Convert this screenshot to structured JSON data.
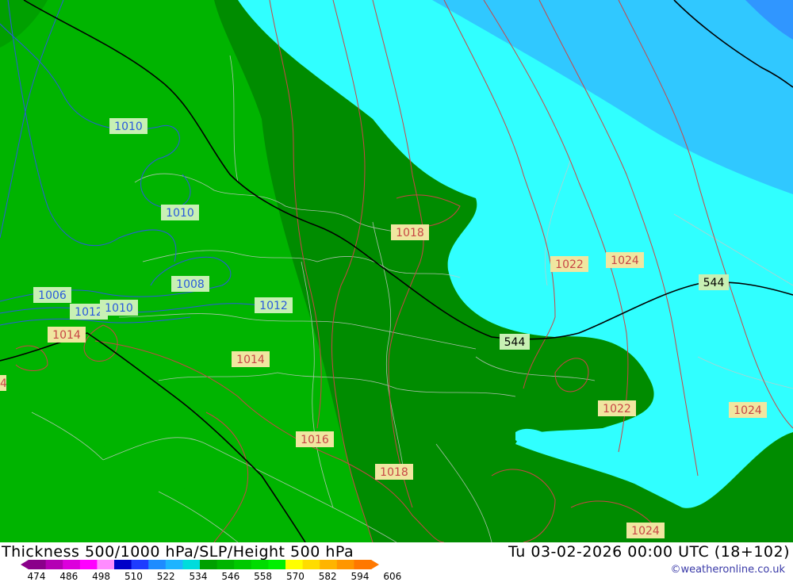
{
  "map": {
    "thickness_contours": [
      "544",
      "544"
    ],
    "pressure_labels_blue": [
      "1010",
      "1010",
      "1006",
      "1012",
      "1010",
      "1008",
      "1012"
    ],
    "pressure_labels_red": [
      "1014",
      "1014",
      "1016",
      "1018",
      "1018",
      "1022",
      "1024",
      "1022",
      "1024",
      "1024",
      "4"
    ],
    "colors": {
      "band_522": "#00c800",
      "band_528": "#00b400",
      "band_534": "#00a000",
      "band_540": "#008c00",
      "band_546": "#00a000",
      "band_552": "#30ffff",
      "band_558": "#30c8ff",
      "band_564": "#3096ff",
      "slp_low": "#2a5adc",
      "slp_high": "#c84646"
    }
  },
  "footer": {
    "title": "Thickness 500/1000 hPa/SLP/Height 500 hPa",
    "datetime": "Tu 03-02-2026 00:00 UTC (18+102)",
    "credit": "©weatheronline.co.uk",
    "scale_ticks": [
      "474",
      "486",
      "498",
      "510",
      "522",
      "534",
      "546",
      "558",
      "570",
      "582",
      "594",
      "606"
    ],
    "scale_colors": [
      "#8a008a",
      "#b400b4",
      "#dc00dc",
      "#ff00ff",
      "#ff8cff",
      "#0000c8",
      "#1e3cff",
      "#1e8cff",
      "#1eb4ff",
      "#00dcdc",
      "#00a000",
      "#00b400",
      "#00c800",
      "#00dc00",
      "#00f000",
      "#ffff00",
      "#ffdc00",
      "#ffb400",
      "#ff9600",
      "#ff7800"
    ]
  }
}
